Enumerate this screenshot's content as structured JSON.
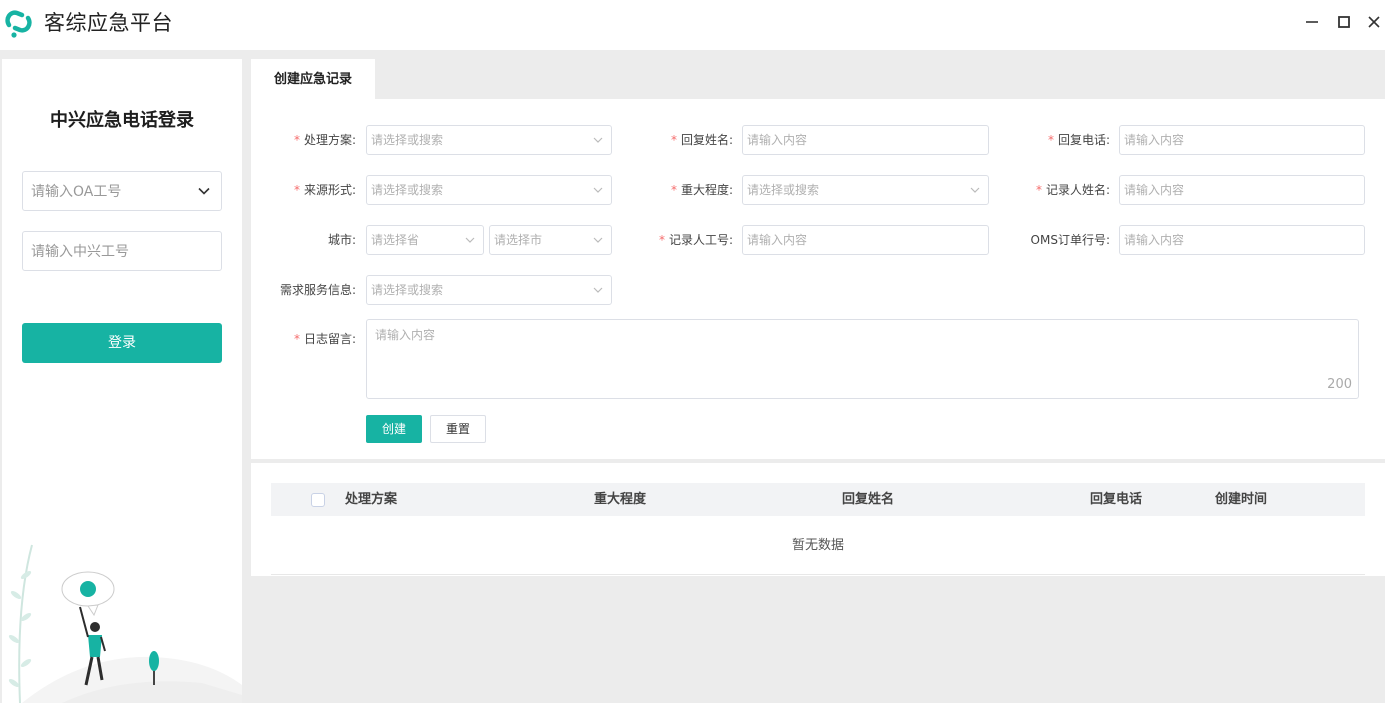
{
  "window": {
    "title": "客综应急平台",
    "controls": {
      "minimize": "minimize-icon",
      "maximize": "maximize-icon",
      "close": "close-icon"
    }
  },
  "login": {
    "title": "中兴应急电话登录",
    "oa_placeholder": "请输入OA工号",
    "zx_placeholder": "请输入中兴工号",
    "button": "登录"
  },
  "tab": {
    "label": "创建应急记录"
  },
  "form": {
    "req_mark": "*",
    "fields": {
      "plan": {
        "label": "处理方案:",
        "placeholder": "请选择或搜索"
      },
      "reply_name": {
        "label": "回复姓名:",
        "placeholder": "请输入内容"
      },
      "reply_phone": {
        "label": "回复电话:",
        "placeholder": "请输入内容"
      },
      "source": {
        "label": "来源形式:",
        "placeholder": "请选择或搜索"
      },
      "severity": {
        "label": "重大程度:",
        "placeholder": "请选择或搜索"
      },
      "recorder_name": {
        "label": "记录人姓名:",
        "placeholder": "请输入内容"
      },
      "city": {
        "label": "城市:",
        "province_placeholder": "请选择省",
        "city_placeholder": "请选择市"
      },
      "recorder_id": {
        "label": "记录人工号:",
        "placeholder": "请输入内容"
      },
      "oms": {
        "label": "OMS订单行号:",
        "placeholder": "请输入内容"
      },
      "service": {
        "label": "需求服务信息:",
        "placeholder": "请选择或搜索"
      },
      "log": {
        "label": "日志留言:",
        "placeholder": "请输入内容",
        "counter": "200"
      }
    },
    "buttons": {
      "create": "创建",
      "reset": "重置"
    }
  },
  "table": {
    "columns": [
      "处理方案",
      "重大程度",
      "回复姓名",
      "回复电话",
      "创建时间"
    ],
    "empty_text": "暂无数据"
  },
  "colors": {
    "accent": "#17b3a3",
    "required": "#f56c6c",
    "background": "#ececec"
  }
}
